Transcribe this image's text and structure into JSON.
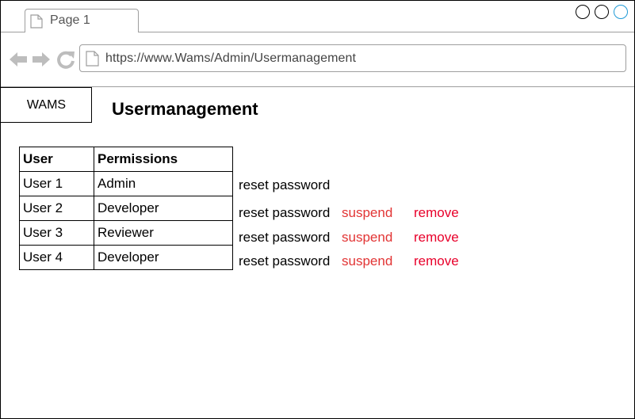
{
  "browser": {
    "tab_label": "Page 1",
    "url": "https://www.Wams/Admin/Usermanagement",
    "icons": {
      "tab": "document-icon",
      "back": "back-arrow-icon",
      "forward": "forward-arrow-icon",
      "reload": "reload-icon",
      "address": "document-icon"
    },
    "window_controls_colors": [
      "#000000",
      "#000000",
      "#1f9ad6"
    ]
  },
  "sidebar": {
    "brand": "WAMS"
  },
  "main": {
    "title": "Usermanagement",
    "table": {
      "headers": [
        "User",
        "Permissions"
      ],
      "rows": [
        {
          "user": "User 1",
          "permission": "Admin",
          "actions": [
            "reset password"
          ]
        },
        {
          "user": "User 2",
          "permission": "Developer",
          "actions": [
            "reset password",
            "suspend",
            "remove"
          ]
        },
        {
          "user": "User 3",
          "permission": "Reviewer",
          "actions": [
            "reset password",
            "suspend",
            "remove"
          ]
        },
        {
          "user": "User 4",
          "permission": "Developer",
          "actions": [
            "reset password",
            "suspend",
            "remove"
          ]
        }
      ]
    },
    "action_colors": {
      "reset": "#000000",
      "suspend": "#e23434",
      "remove": "#e8002a"
    }
  }
}
